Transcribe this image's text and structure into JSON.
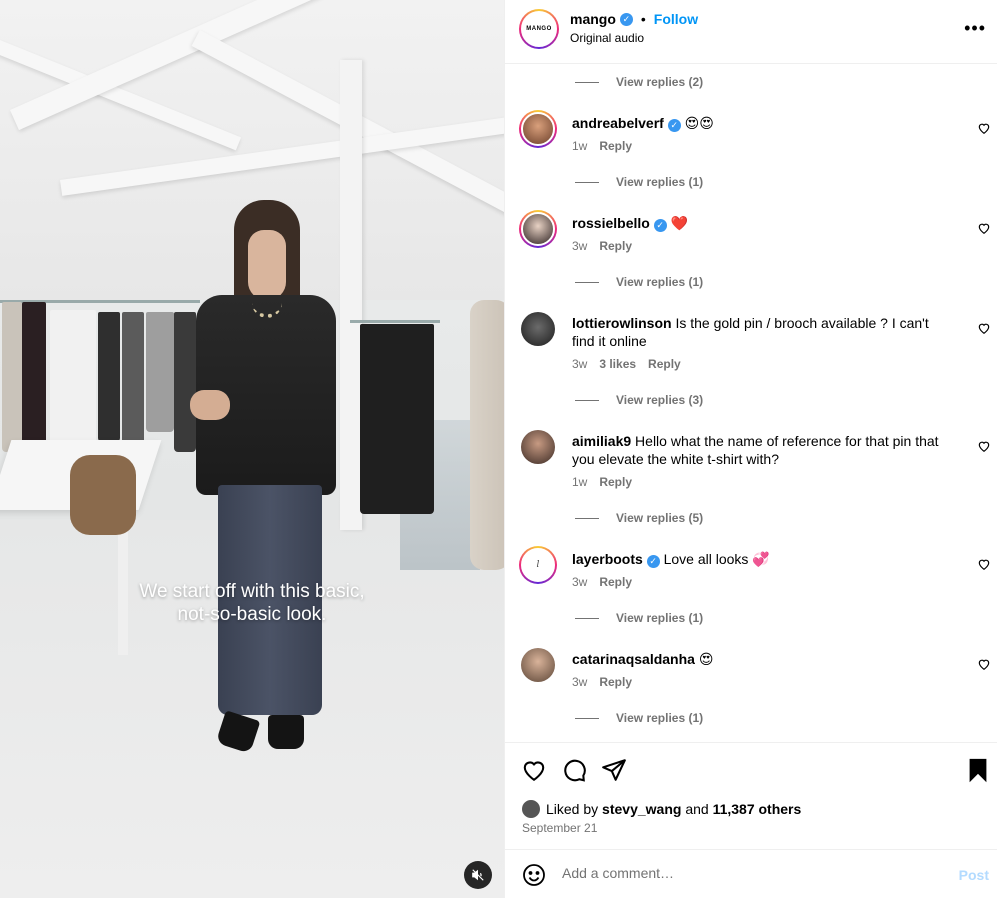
{
  "post": {
    "media": {
      "caption_line1": "We start off with this basic,",
      "caption_line2": "not-so-basic look."
    },
    "header": {
      "username": "mango",
      "avatar_text": "MANGO",
      "separator": "•",
      "follow_label": "Follow",
      "subtitle": "Original audio",
      "more_icon": "more-horizontal-icon"
    },
    "replies_top": "View replies (2)",
    "comments": [
      {
        "user": "andreabelverf",
        "verified": true,
        "text": "😍😍",
        "time": "1w",
        "likes": "",
        "reply": "Reply",
        "view_replies": "View replies (1)"
      },
      {
        "user": "rossielbello",
        "verified": true,
        "text": "❤️",
        "time": "3w",
        "likes": "",
        "reply": "Reply",
        "view_replies": "View replies (1)"
      },
      {
        "user": "lottierowlinson",
        "verified": false,
        "text": "Is the gold pin / brooch available ? I can't find it online",
        "time": "3w",
        "likes": "3 likes",
        "reply": "Reply",
        "view_replies": "View replies (3)"
      },
      {
        "user": "aimiliak9",
        "verified": false,
        "text": "Hello what the name of reference for that pin that you elevate the white t-shirt with?",
        "time": "1w",
        "likes": "",
        "reply": "Reply",
        "view_replies": "View replies (5)"
      },
      {
        "user": "layerboots",
        "verified": true,
        "text": "Love all looks 💞",
        "time": "3w",
        "likes": "",
        "reply": "Reply",
        "view_replies": "View replies (1)"
      },
      {
        "user": "catarinaqsaldanha",
        "verified": false,
        "text": "😍",
        "time": "3w",
        "likes": "",
        "reply": "Reply",
        "view_replies": "View replies (1)"
      }
    ],
    "actions": {
      "liked_prefix": "Liked by",
      "liked_user": "stevy_wang",
      "liked_and": "and",
      "liked_others": "11,387 others",
      "date": "September 21"
    },
    "add_comment": {
      "placeholder": "Add a comment…",
      "post_label": "Post"
    }
  },
  "colors": {
    "accent": "#0095f6",
    "muted": "#737373",
    "post_disabled": "#b3dbff",
    "verified": "#3897f0"
  }
}
